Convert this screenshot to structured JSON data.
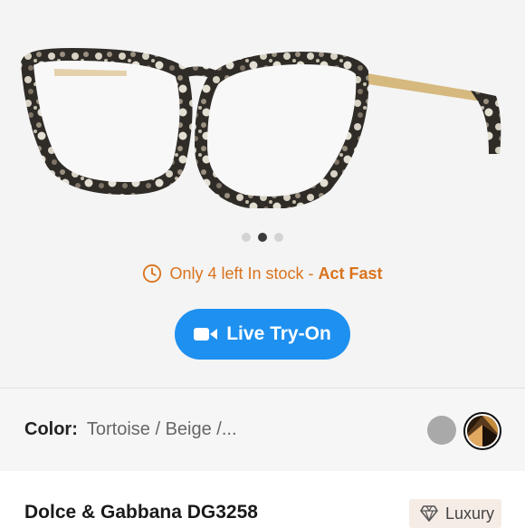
{
  "carousel": {
    "page_count": 3,
    "active_index": 1
  },
  "stock": {
    "message": "Only 4 left In stock - ",
    "urgency": "Act Fast",
    "icon": "clock-icon",
    "color": "#d9731d"
  },
  "tryon": {
    "label": "Live Try-On",
    "icon": "video-camera-icon",
    "color": "#1e90f0"
  },
  "color": {
    "label": "Color:",
    "value": "Tortoise / Beige /...",
    "swatches": [
      {
        "name": "grey",
        "color": "#a9a9a9",
        "selected": false
      },
      {
        "name": "tortoise",
        "color": "#8b5a2b",
        "selected": true
      }
    ]
  },
  "product": {
    "name": "Dolce & Gabbana DG3258",
    "badge": {
      "label": "Luxury",
      "icon": "diamond-icon"
    }
  }
}
